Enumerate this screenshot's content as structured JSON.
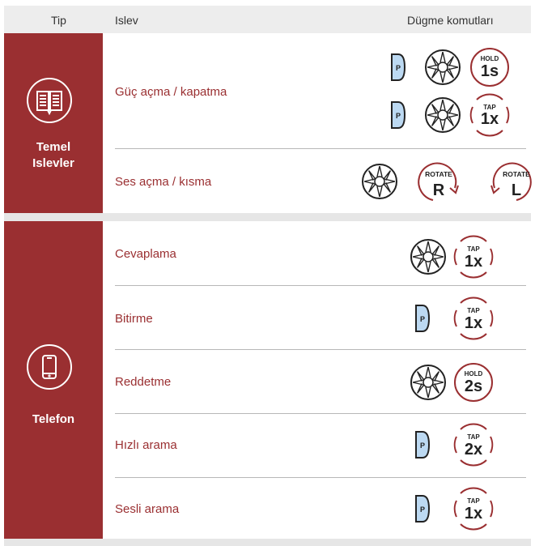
{
  "header": {
    "col_type": "Tip",
    "col_function": "Islev",
    "col_buttons": "Dügme komutları"
  },
  "sections": [
    {
      "name": "Temel\nIslevler",
      "line1": "Temel",
      "line2": "Islevler",
      "icon": "book-icon",
      "rows": [
        {
          "label": "Güç açma / kapatma"
        },
        {
          "label": "Ses açma / kısma"
        }
      ]
    },
    {
      "name": "Telefon",
      "icon": "phone-icon",
      "rows": [
        {
          "label": "Cevaplama"
        },
        {
          "label": "Bitirme"
        },
        {
          "label": "Reddetme"
        },
        {
          "label": "Hızlı arama"
        },
        {
          "label": "Sesli arama"
        }
      ]
    }
  ],
  "badges": {
    "hold": "HOLD",
    "tap": "TAP",
    "rotate": "ROTATE",
    "v_1s": "1s",
    "v_1x": "1x",
    "v_2s": "2s",
    "v_2x": "2x",
    "v_R": "R",
    "v_L": "L",
    "p": "P"
  },
  "colors": {
    "accent": "#9a2f31",
    "p_button": "#bcd9f2",
    "header_bg": "#ededed"
  }
}
